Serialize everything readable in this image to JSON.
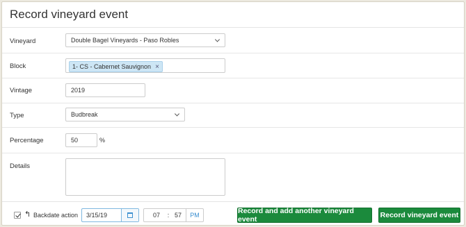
{
  "dialog": {
    "title": "Record vineyard event"
  },
  "fields": {
    "vineyard": {
      "label": "Vineyard",
      "value": "Double Bagel Vineyards - Paso Robles"
    },
    "block": {
      "label": "Block",
      "tag": "1- CS - Cabernet Sauvignon",
      "remove_glyph": "×"
    },
    "vintage": {
      "label": "Vintage",
      "value": "2019"
    },
    "type": {
      "label": "Type",
      "value": "Budbreak"
    },
    "percentage": {
      "label": "Percentage",
      "value": "50",
      "unit": "%"
    },
    "details": {
      "label": "Details",
      "value": ""
    }
  },
  "footer": {
    "backdate_checked": true,
    "undo_glyph": "↰",
    "backdate_label": "Backdate action",
    "date": "3/15/19",
    "hour": "07",
    "separator": ":",
    "minute": "57",
    "ampm": "PM",
    "record_another_label": "Record and add another vineyard event",
    "record_label": "Record vineyard event",
    "button_color": "#1b8a3c"
  }
}
